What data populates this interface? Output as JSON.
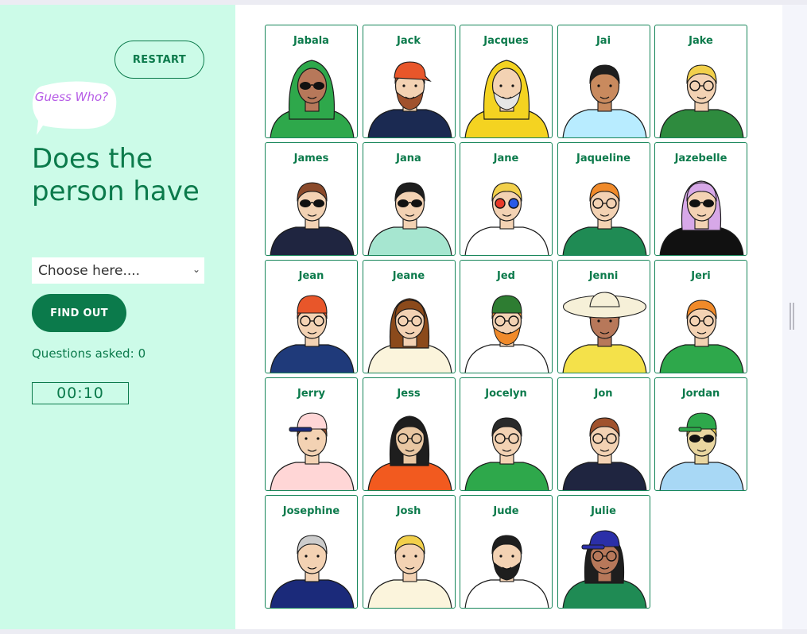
{
  "controls": {
    "restart_label": "RESTART",
    "bubble_text": "Guess Who?",
    "question": "Does the person have",
    "select_value": "Choose here....",
    "findout_label": "FIND OUT",
    "questions_label": "Questions asked:",
    "questions_count": "0",
    "timer": "00:10"
  },
  "colors": {
    "accent": "#0b7a4b",
    "sidebar_bg": "#ccfbe8",
    "bubble_text": "#b65ce6"
  },
  "characters": [
    {
      "name": "Jabala",
      "skin": "#b7785a",
      "hair": "#2ea84b",
      "shirt": "#2ea84b",
      "glasses": "sunglasses",
      "hat": "hijab"
    },
    {
      "name": "Jack",
      "skin": "#f3d2b3",
      "hair": "#a0522d",
      "shirt": "#1b2a52",
      "glasses": "",
      "hat": "bandana",
      "beard": true
    },
    {
      "name": "Jacques",
      "skin": "#f3d2b3",
      "hair": "#dddddd",
      "shirt": "#f4d321",
      "glasses": "",
      "hat": "hood",
      "beard": true
    },
    {
      "name": "Jai",
      "skin": "#c98a5e",
      "hair": "#1e1e1e",
      "shirt": "#b8ecff",
      "glasses": ""
    },
    {
      "name": "Jake",
      "skin": "#f3d2b3",
      "hair": "#f2d04b",
      "shirt": "#2e8b3e",
      "glasses": "round"
    },
    {
      "name": "James",
      "skin": "#f3d2b3",
      "hair": "#8b4a2b",
      "shirt": "#1f2540",
      "glasses": "sunglasses"
    },
    {
      "name": "Jana",
      "skin": "#f3d2b3",
      "hair": "#1e1e1e",
      "shirt": "#a6e6d0",
      "glasses": "sunglasses"
    },
    {
      "name": "Jane",
      "skin": "#f3d2b3",
      "hair": "#f2d04b",
      "shirt": "#ffffff",
      "glasses": "color"
    },
    {
      "name": "Jaqueline",
      "skin": "#f3d2b3",
      "hair": "#f08a2a",
      "shirt": "#1f8b54",
      "glasses": "round"
    },
    {
      "name": "Jazebelle",
      "skin": "#f3d2b3",
      "hair": "#d7a8e8",
      "shirt": "#111111",
      "glasses": "sunglasses"
    },
    {
      "name": "Jean",
      "skin": "#f3d2b3",
      "hair": "#e8562a",
      "shirt": "#1f3a7a",
      "glasses": "round",
      "hat": "beanie"
    },
    {
      "name": "Jeane",
      "skin": "#f3d2b3",
      "hair": "#8b4a1b",
      "shirt": "#fbf4dc",
      "glasses": "round"
    },
    {
      "name": "Jed",
      "skin": "#f3d2b3",
      "hair": "#f08a2a",
      "shirt": "#ffffff",
      "glasses": "round",
      "hat": "beanie-green",
      "beard": true
    },
    {
      "name": "Jenni",
      "skin": "#b7785a",
      "hair": "#1e1e1e",
      "shirt": "#f4e14a",
      "glasses": "",
      "hat": "sunhat"
    },
    {
      "name": "Jeri",
      "skin": "#f3d2b3",
      "hair": "#f08a2a",
      "shirt": "#2ea84b",
      "glasses": "round"
    },
    {
      "name": "Jerry",
      "skin": "#f3d2b3",
      "hair": "#8b4a2b",
      "shirt": "#ffd6d6",
      "glasses": "",
      "hat": "cap-pink"
    },
    {
      "name": "Jess",
      "skin": "#e9c7a2",
      "hair": "#1e1e1e",
      "shirt": "#f25a1f",
      "glasses": "round"
    },
    {
      "name": "Jocelyn",
      "skin": "#f3d2b3",
      "hair": "#2a2a2a",
      "shirt": "#2ea84b",
      "glasses": "round"
    },
    {
      "name": "Jon",
      "skin": "#f3d2b3",
      "hair": "#a0522d",
      "shirt": "#1f2540",
      "glasses": "round"
    },
    {
      "name": "Jordan",
      "skin": "#e9d6a0",
      "hair": "#f2d04b",
      "shirt": "#a8d8f5",
      "glasses": "sunglasses",
      "hat": "cap-green"
    },
    {
      "name": "Josephine",
      "skin": "#f3d2b3",
      "hair": "#cccccc",
      "shirt": "#1b2a7a",
      "glasses": ""
    },
    {
      "name": "Josh",
      "skin": "#f3d2b3",
      "hair": "#f2d04b",
      "shirt": "#fbf4dc",
      "glasses": ""
    },
    {
      "name": "Jude",
      "skin": "#f3d2b3",
      "hair": "#1e1e1e",
      "shirt": "#ffffff",
      "glasses": "",
      "beard": true
    },
    {
      "name": "Julie",
      "skin": "#b7785a",
      "hair": "#1e1e1e",
      "shirt": "#1f8b54",
      "glasses": "round",
      "hat": "cap-blue"
    }
  ]
}
